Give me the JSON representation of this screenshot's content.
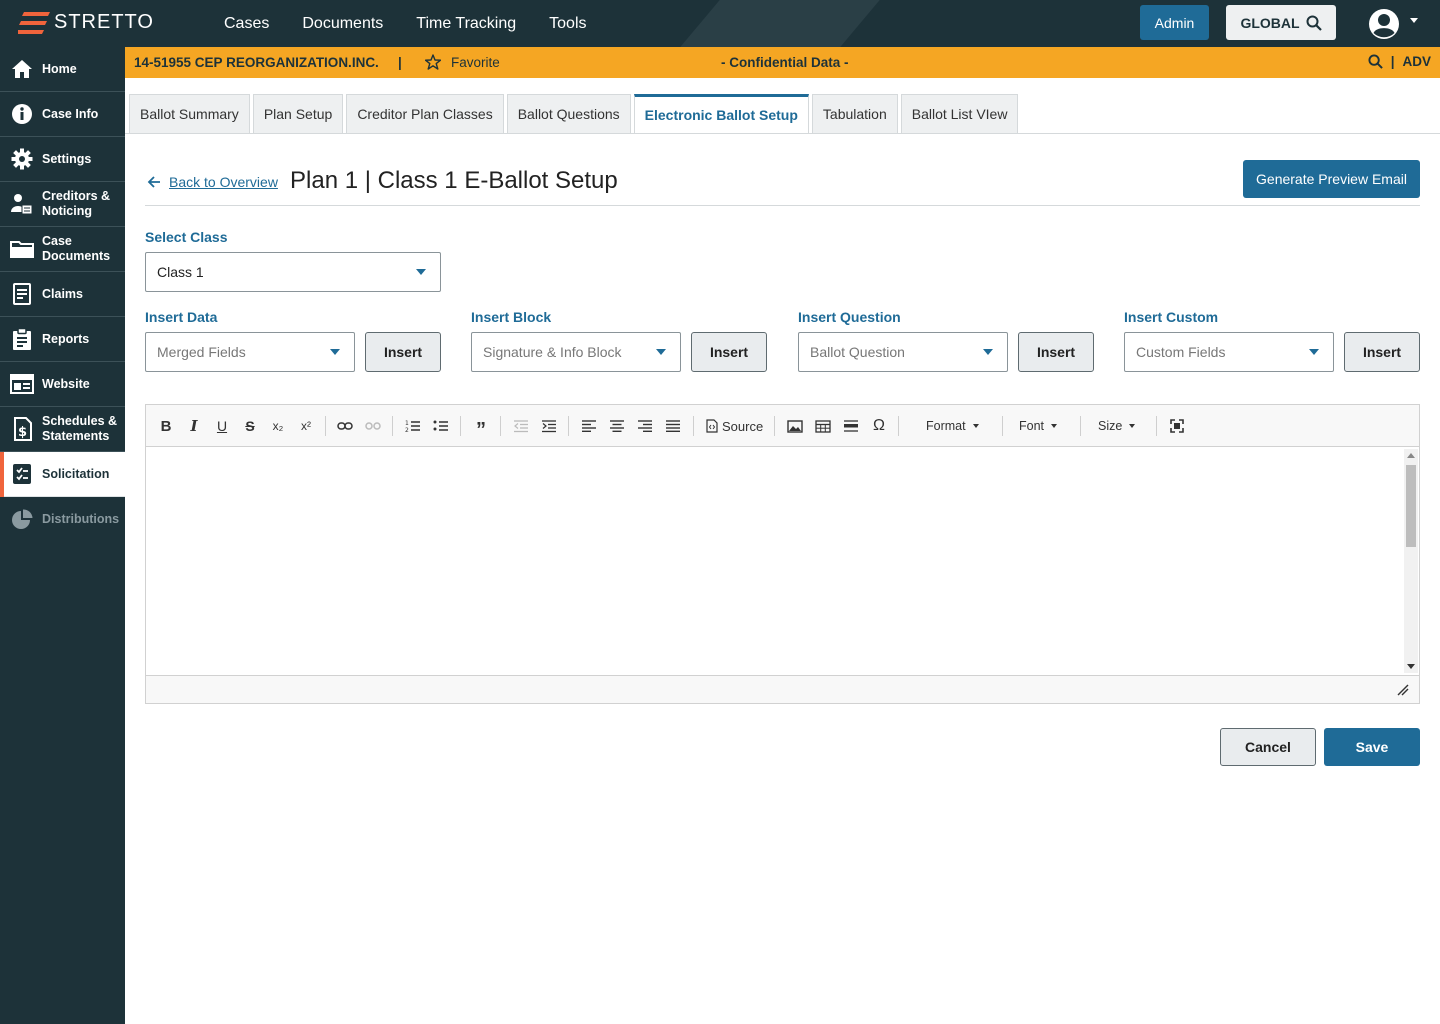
{
  "brand": {
    "name": "STRETTO",
    "accent": "#f0643c"
  },
  "topnav": {
    "items": [
      "Cases",
      "Documents",
      "Time Tracking",
      "Tools"
    ]
  },
  "header": {
    "admin_label": "Admin",
    "global_label": "GLOBAL"
  },
  "sidebar": {
    "items": [
      {
        "label": "Home",
        "icon": "home-icon"
      },
      {
        "label": "Case Info",
        "icon": "info-icon"
      },
      {
        "label": "Settings",
        "icon": "gear-icon"
      },
      {
        "label": "Creditors &\nNoticing",
        "icon": "people-icon"
      },
      {
        "label": "Case\nDocuments",
        "icon": "folder-icon"
      },
      {
        "label": "Claims",
        "icon": "claims-icon"
      },
      {
        "label": "Reports",
        "icon": "clipboard-icon"
      },
      {
        "label": "Website",
        "icon": "browser-icon"
      },
      {
        "label": "Schedules &\nStatements",
        "icon": "document-dollar-icon"
      },
      {
        "label": "Solicitation",
        "icon": "checklist-icon",
        "active": true
      },
      {
        "label": "Distributions",
        "icon": "pie-chart-icon",
        "disabled": true
      }
    ]
  },
  "casebar": {
    "case_id": "14-51955 CEP REORGANIZATION.INC.",
    "separator": "|",
    "favorite_label": "Favorite",
    "confidential": "- Confidential Data -",
    "right_separator": "|",
    "adv_label": "ADV"
  },
  "tabs": [
    {
      "label": "Ballot Summary"
    },
    {
      "label": "Plan Setup"
    },
    {
      "label": "Creditor Plan Classes"
    },
    {
      "label": "Ballot Questions"
    },
    {
      "label": "Electronic Ballot Setup",
      "active": true
    },
    {
      "label": "Tabulation"
    },
    {
      "label": "Ballot List VIew"
    }
  ],
  "page": {
    "back_label": "Back to Overview",
    "title": "Plan 1 | Class 1 E-Ballot Setup",
    "preview_button": "Generate Preview Email"
  },
  "form": {
    "select_class": {
      "label": "Select Class",
      "value": "Class 1"
    },
    "insert_data": {
      "label": "Insert Data",
      "placeholder": "Merged Fields",
      "button": "Insert"
    },
    "insert_block": {
      "label": "Insert Block",
      "placeholder": "Signature & Info Block",
      "button": "Insert"
    },
    "insert_question": {
      "label": "Insert Question",
      "placeholder": "Ballot Question",
      "button": "Insert"
    },
    "insert_custom": {
      "label": "Insert Custom",
      "placeholder": "Custom Fields",
      "button": "Insert"
    }
  },
  "editor": {
    "source_label": "Source",
    "format_label": "Format",
    "font_label": "Font",
    "size_label": "Size",
    "content": ""
  },
  "actions": {
    "cancel": "Cancel",
    "save": "Save"
  }
}
